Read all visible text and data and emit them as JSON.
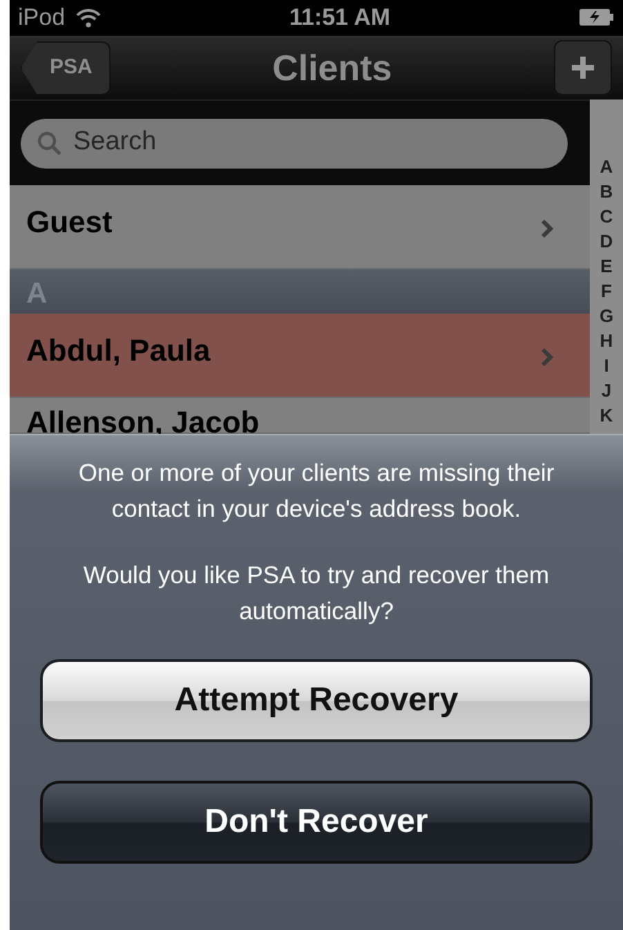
{
  "status_bar": {
    "carrier": "iPod",
    "time": "11:51 AM"
  },
  "nav_bar": {
    "back_button": "PSA",
    "title": "Clients"
  },
  "search": {
    "placeholder": "Search"
  },
  "list": [
    {
      "kind": "row",
      "name": "Guest",
      "highlighted": false
    },
    {
      "kind": "header",
      "label": "A"
    },
    {
      "kind": "row",
      "name": "Abdul, Paula",
      "highlighted": true
    },
    {
      "kind": "row",
      "name": "Allenson, Jacob",
      "highlighted": false
    }
  ],
  "index": [
    "A",
    "B",
    "C",
    "D",
    "E",
    "F",
    "G",
    "H",
    "I",
    "J",
    "K"
  ],
  "action_sheet": {
    "messages": [
      "One or more of your clients are missing their contact in your device's address book.",
      "Would you like PSA to try and recover them automatically?"
    ],
    "buttons": [
      {
        "label": "Attempt Recovery",
        "kind": "default"
      },
      {
        "label": "Don't Recover",
        "kind": "cancel"
      }
    ]
  }
}
